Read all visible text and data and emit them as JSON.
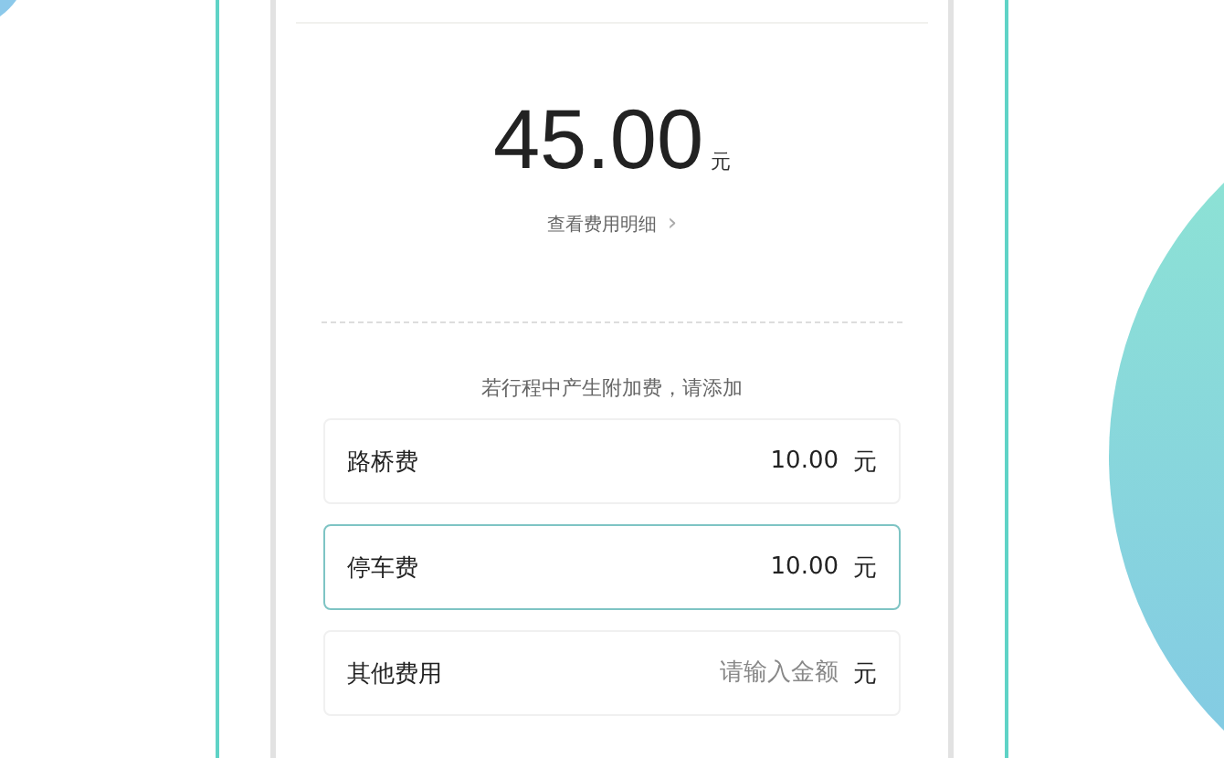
{
  "total": {
    "amount": "45.00",
    "unit": "元"
  },
  "detail_link": {
    "label": "查看费用明细",
    "arrow": "›"
  },
  "hint": "若行程中产生附加费，请添加",
  "fees": [
    {
      "label": "路桥费",
      "value": "10.00",
      "unit": "元",
      "selected": false
    },
    {
      "label": "停车费",
      "value": "10.00",
      "unit": "元",
      "selected": true
    },
    {
      "label": "其他费用",
      "placeholder": "请输入金额",
      "unit": "元",
      "selected": false
    }
  ]
}
